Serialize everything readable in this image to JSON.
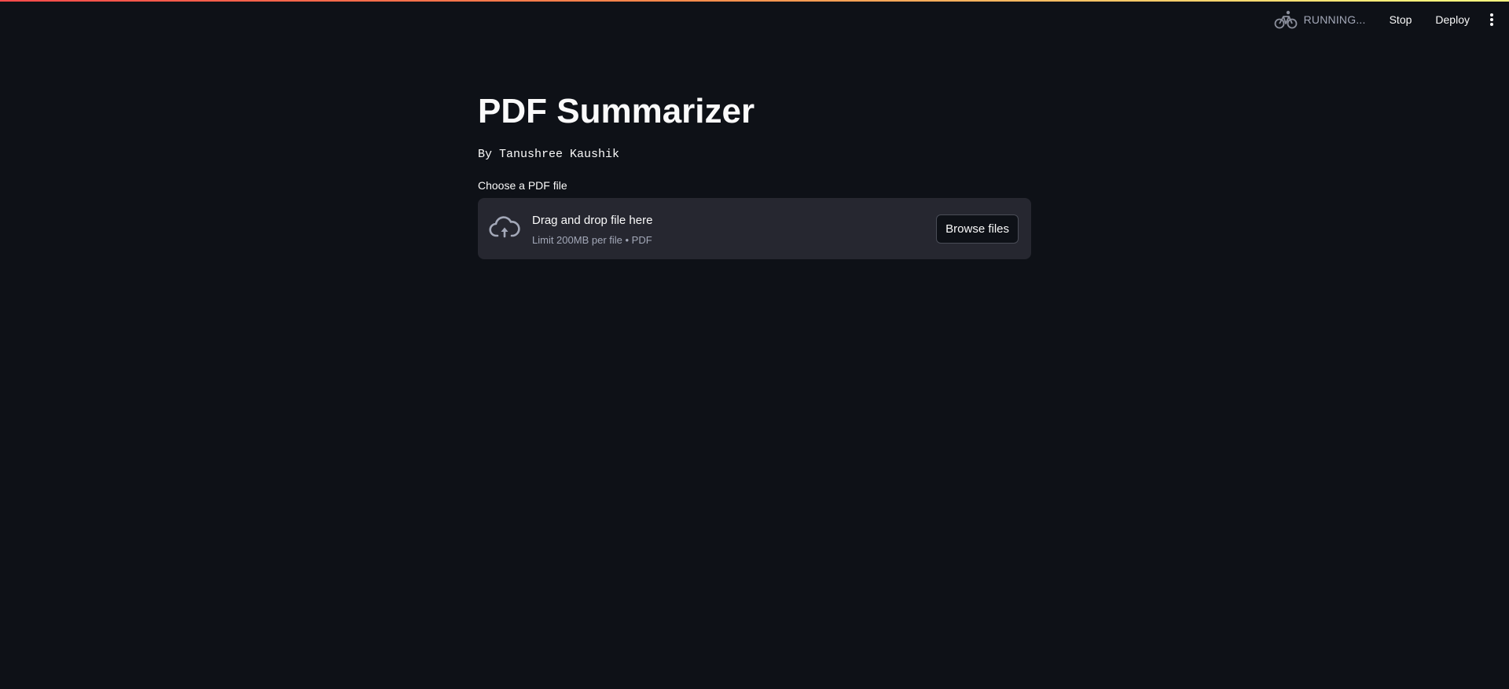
{
  "header": {
    "status_icon": "bicycle-running-icon",
    "status_text": "RUNNING...",
    "stop_label": "Stop",
    "deploy_label": "Deploy",
    "menu_icon": "kebab-menu-icon"
  },
  "main": {
    "title": "PDF Summarizer",
    "byline": "By Tanushree Kaushik",
    "uploader": {
      "label": "Choose a PDF file",
      "icon": "cloud-upload-icon",
      "instructions": "Drag and drop file here",
      "limit_text": "Limit 200MB per file • PDF",
      "browse_label": "Browse files"
    }
  },
  "colors": {
    "background": "#0e1117",
    "dropzone": "#262730",
    "text": "#fafafa",
    "muted_text": "#a3a8b8",
    "accent_gradient_start": "#ff4b4b",
    "accent_gradient_end": "#fffd80"
  }
}
